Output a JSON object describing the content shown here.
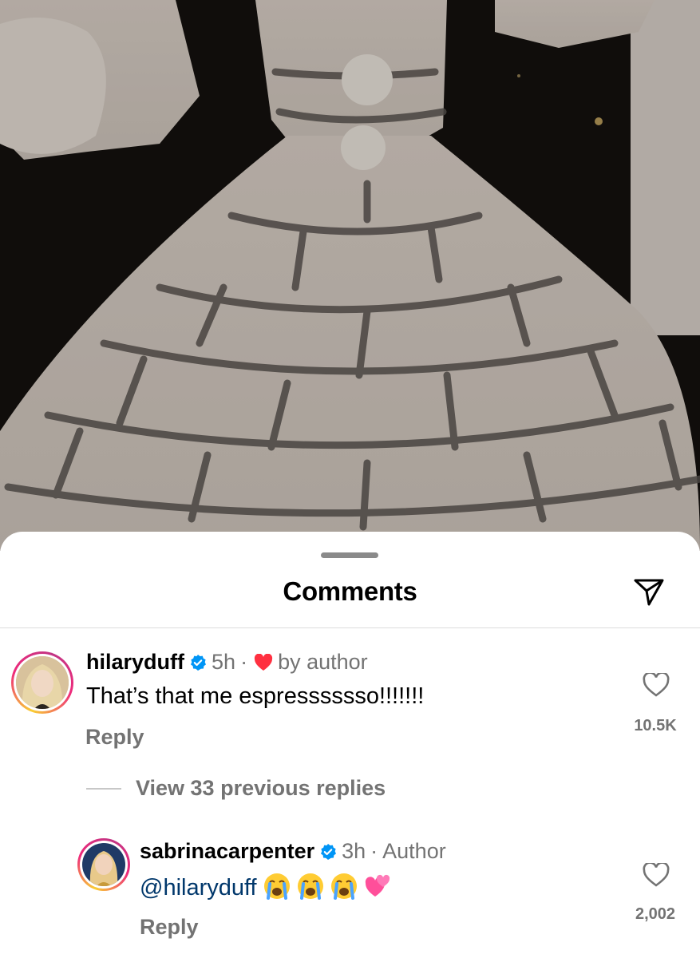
{
  "sheet": {
    "title": "Comments",
    "share_icon": "paper-plane-icon"
  },
  "comments": [
    {
      "username": "hilaryduff",
      "verified": true,
      "time": "5h",
      "separator": "·",
      "liked_by_author_label": "by author",
      "text": "That’s that me espresssssso!!!!!!!",
      "reply_label": "Reply",
      "like_count": "10.5K"
    }
  ],
  "view_replies_label": "View 33 previous replies",
  "replies": [
    {
      "username": "sabrinacarpenter",
      "verified": true,
      "time": "3h",
      "separator": "·",
      "badge": "Author",
      "mention": "@hilaryduff",
      "emojis": [
        "loudly-crying-face",
        "loudly-crying-face",
        "loudly-crying-face",
        "two-hearts"
      ],
      "reply_label": "Reply",
      "like_count": "2,002"
    }
  ],
  "colors": {
    "verified_blue": "#0095f6",
    "heart_red": "#ff3040",
    "muted_text": "#737373",
    "mention_blue": "#00376b"
  }
}
